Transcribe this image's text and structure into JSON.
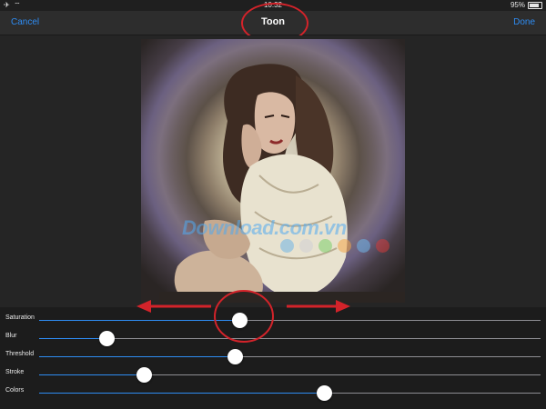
{
  "status_bar": {
    "time": "10:32",
    "battery": "95%",
    "battery_level": 0.95
  },
  "nav": {
    "cancel_label": "Cancel",
    "title": "Toon",
    "done_label": "Done"
  },
  "watermark": {
    "text": "Download.com.vn",
    "dot_colors": [
      "#6fb4e6",
      "#cfcfd6",
      "#7ccf6b",
      "#f2a64a",
      "#6fb4e6",
      "#d23a3a"
    ]
  },
  "sliders": [
    {
      "label": "Saturation",
      "value": 0.4
    },
    {
      "label": "Blur",
      "value": 0.135
    },
    {
      "label": "Threshold",
      "value": 0.39
    },
    {
      "label": "Stroke",
      "value": 0.208
    },
    {
      "label": "Colors",
      "value": 0.568
    }
  ],
  "colors": {
    "accent": "#2e8cf3",
    "annotation": "#d3232a"
  }
}
